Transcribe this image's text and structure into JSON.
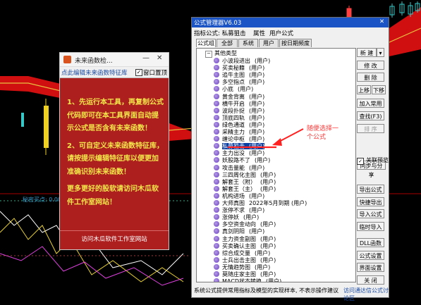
{
  "chart": {
    "indicator_label": "秘密买点: 0.00"
  },
  "small_window": {
    "title": "未来函数检...",
    "link": "点此编辑未来函数特征库",
    "topmost_label": "窗口置顶",
    "topmost_checked": true,
    "paragraphs": [
      "1、先运行本工具，再复制公式代码即可在本工具界面自动提示公式是否含有未来函数！",
      "2、可自定义未来函数特征库，请按提示编辑特征库以便更加准确识别未来函数！",
      "更多更好的股软请访问木瓜软件工作室网站！"
    ],
    "footer": "访问木瓜软件工作室网站"
  },
  "formula_manager": {
    "title": "公式管理器V6.03",
    "menu": [
      "指标公式: 私募狙击",
      "属性",
      "用户公式"
    ],
    "tabs": [
      "公式组",
      "全部",
      "系统",
      "用户",
      "按日期频度"
    ],
    "tree_root": "其他类型",
    "tree_items": [
      {
        "name": "小波段进出",
        "tag": "(用户)"
      },
      {
        "name": "买卖秘籍",
        "tag": "(用户)"
      },
      {
        "name": "追牛主图",
        "tag": "(用户)"
      },
      {
        "name": "多空指点",
        "tag": "(用户)"
      },
      {
        "name": "小底",
        "tag": "(用户)"
      },
      {
        "name": "黄金背离",
        "tag": "(用户)"
      },
      {
        "name": "横牛开启",
        "tag": "(用户)"
      },
      {
        "name": "波段扑捉",
        "tag": "(用户)"
      },
      {
        "name": "顶底四轨",
        "tag": "(用户)"
      },
      {
        "name": "绿色通道",
        "tag": "(用户)"
      },
      {
        "name": "采精主力",
        "tag": "(用户)"
      },
      {
        "name": "缠论中枢",
        "tag": "(用户)"
      },
      {
        "name": "私募狙击",
        "tag": "(用户)",
        "selected": true
      },
      {
        "name": "主力出没",
        "tag": "(用户)"
      },
      {
        "name": "妖股路不了",
        "tag": "(用户)"
      },
      {
        "name": "攻击量能",
        "tag": "(用户)"
      },
      {
        "name": "三四周化主图",
        "tag": "(用户)"
      },
      {
        "name": "解套王（附）",
        "tag": "(用户)"
      },
      {
        "name": "解套王（主）",
        "tag": "(用户)"
      },
      {
        "name": "机构进场",
        "tag": "(用户)"
      },
      {
        "name": "大师真图",
        "tag": "2022年5月到期 (用户)"
      },
      {
        "name": "涨停不求",
        "tag": "(用户)"
      },
      {
        "name": "涨停妖",
        "tag": "(用户)"
      },
      {
        "name": "多空资金动向",
        "tag": "(用户)"
      },
      {
        "name": "真剑阴阳",
        "tag": "(用户)"
      },
      {
        "name": "主力资金副图",
        "tag": "(用户)"
      },
      {
        "name": "买卖确认主图",
        "tag": "(用户)"
      },
      {
        "name": "综合成交量",
        "tag": "(用户)"
      },
      {
        "name": "士兵出击主图",
        "tag": "(用户)"
      },
      {
        "name": "无情趋势图",
        "tag": "(用户)"
      },
      {
        "name": "莫随庄家主图",
        "tag": "(用户)"
      },
      {
        "name": "MACD状态转换",
        "tag": "(用户)"
      }
    ],
    "buttons": {
      "new": "新 建",
      "modify": "修 改",
      "delete": "删 除",
      "move_up": "上移",
      "move_down": "下移",
      "add_to_user": "加入常用",
      "find": "查找(F3)",
      "sort": "排 序",
      "link_preview": "关联预览",
      "sync": "同步与分享",
      "export": "导出公式",
      "quick_export": "快捷导出",
      "import": "导入公式",
      "temp_import": "临时导入",
      "dll": "DLL函数",
      "formula_settings": "公式设置",
      "ui_settings": "界面设置",
      "close": "关 闭"
    },
    "status_left": "系统公式提供常用指标及模型的实现样本, 不表示操作建议",
    "status_right": "访问通达信公式讨论区"
  },
  "annotation": {
    "line1": "随便选择一",
    "line2": "个公式"
  },
  "colors": {
    "accent_blue": "#1b55c5",
    "window_red": "#ad1f1f",
    "annotation_red": "#ff3838"
  }
}
